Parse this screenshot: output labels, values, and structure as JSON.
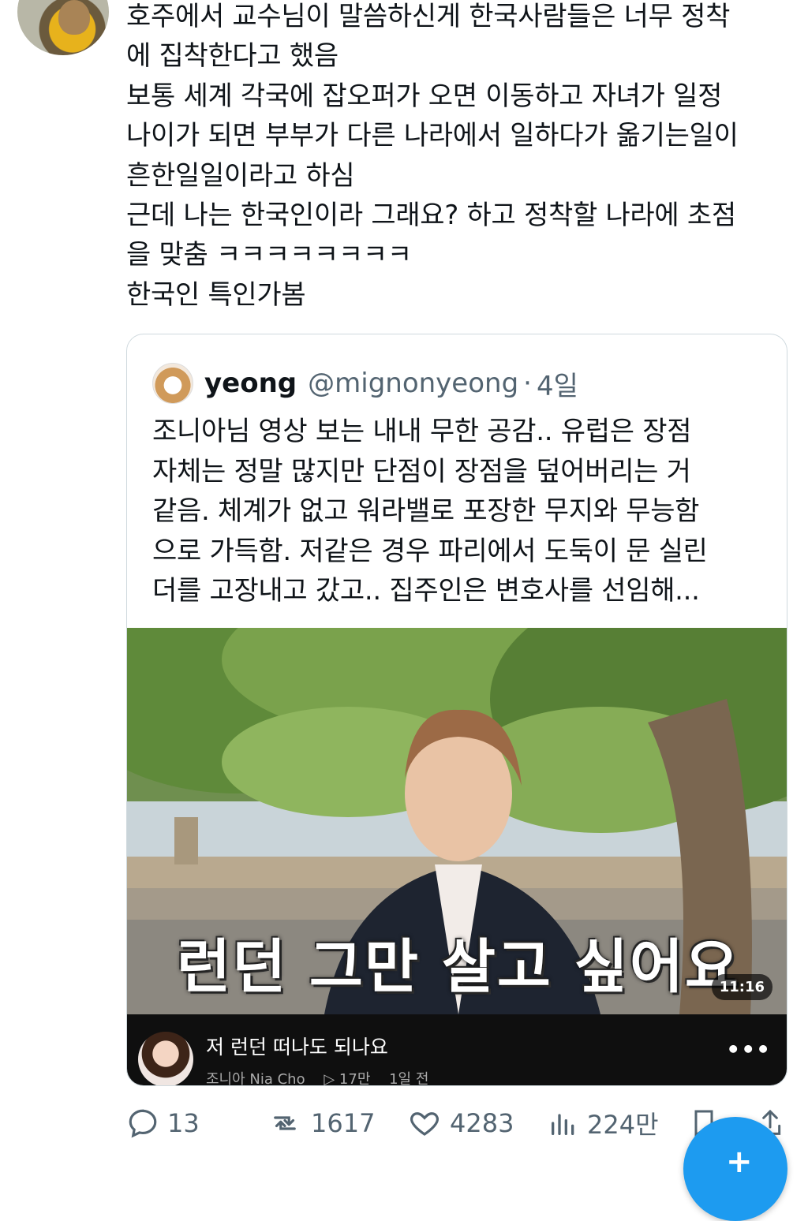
{
  "tweet": {
    "text": "호주에서 교수님이 말씀하신게 한국사람들은 너무 정착\n에 집착한다고 했음\n보통 세계 각국에 잡오퍼가 오면 이동하고 자녀가 일정\n나이가 되면 부부가 다른 나라에서 일하다가 옮기는일이\n흔한일일이라고 하심\n근데 나는 한국인이라 그래요? 하고 정착할 나라에 초점\n을 맞춤 ㅋㅋㅋㅋㅋㅋㅋㅋ\n한국인 특인가봄"
  },
  "quoted": {
    "name": "yeong",
    "handle": "@mignonyeong",
    "separator": "·",
    "time": "4일",
    "text": "조니아님 영상 보는 내내 무한 공감.. 유럽은 장점\n자체는 정말 많지만 단점이 장점을 덮어버리는 거\n같음. 체계가 없고 워라밸로 포장한 무지와 무능함\n으로 가득함. 저같은 경우 파리에서 도둑이 문 실린\n더를 고장내고 갔고.. 집주인은 변호사를 선임해...",
    "video": {
      "caption": "런던 그만 살고 싶어요",
      "duration": "11:16",
      "title": "저 런던 떠나도 되나요",
      "channel": "조니아 Nia Cho",
      "views": "▷ 17만",
      "age": "1일 전",
      "more": "•••"
    }
  },
  "actions": {
    "replies": "13",
    "retweets": "1617",
    "likes": "4283",
    "views": "224만"
  },
  "colors": {
    "accent": "#1d9bf0",
    "muted": "#536471",
    "border": "#cfd9de"
  }
}
